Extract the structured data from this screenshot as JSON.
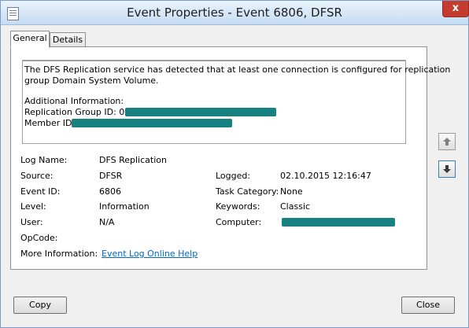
{
  "window": {
    "title": "Event Properties - Event 6806, DFSR",
    "close_label": "x"
  },
  "tabs": [
    {
      "label": "General"
    },
    {
      "label": "Details"
    }
  ],
  "description": {
    "line1": "The DFS Replication service has detected that at least one connection is configured for replication",
    "line2": "group Domain System Volume.",
    "additional_info_label": "Additional Information:",
    "replication_group_label": "Replication Group ID: 00",
    "member_label": "Member ID:"
  },
  "fields": {
    "log_name_label": "Log Name:",
    "log_name_value": "DFS Replication",
    "source_label": "Source:",
    "source_value": "DFSR",
    "logged_label": "Logged:",
    "logged_value": "02.10.2015 12:16:47",
    "event_id_label": "Event ID:",
    "event_id_value": "6806",
    "task_category_label": "Task Category:",
    "task_category_value": "None",
    "level_label": "Level:",
    "level_value": "Information",
    "keywords_label": "Keywords:",
    "keywords_value": "Classic",
    "user_label": "User:",
    "user_value": "N/A",
    "computer_label": "Computer:",
    "opcode_label": "OpCode:",
    "more_info_label": "More Information:",
    "more_info_link": "Event Log Online Help"
  },
  "buttons": {
    "copy": "Copy",
    "close": "Close"
  },
  "colors": {
    "redaction": "#178080",
    "link": "#0066cc"
  },
  "icons": {
    "up": "arrow-up-icon",
    "down": "arrow-down-icon",
    "app": "event-viewer-icon"
  }
}
